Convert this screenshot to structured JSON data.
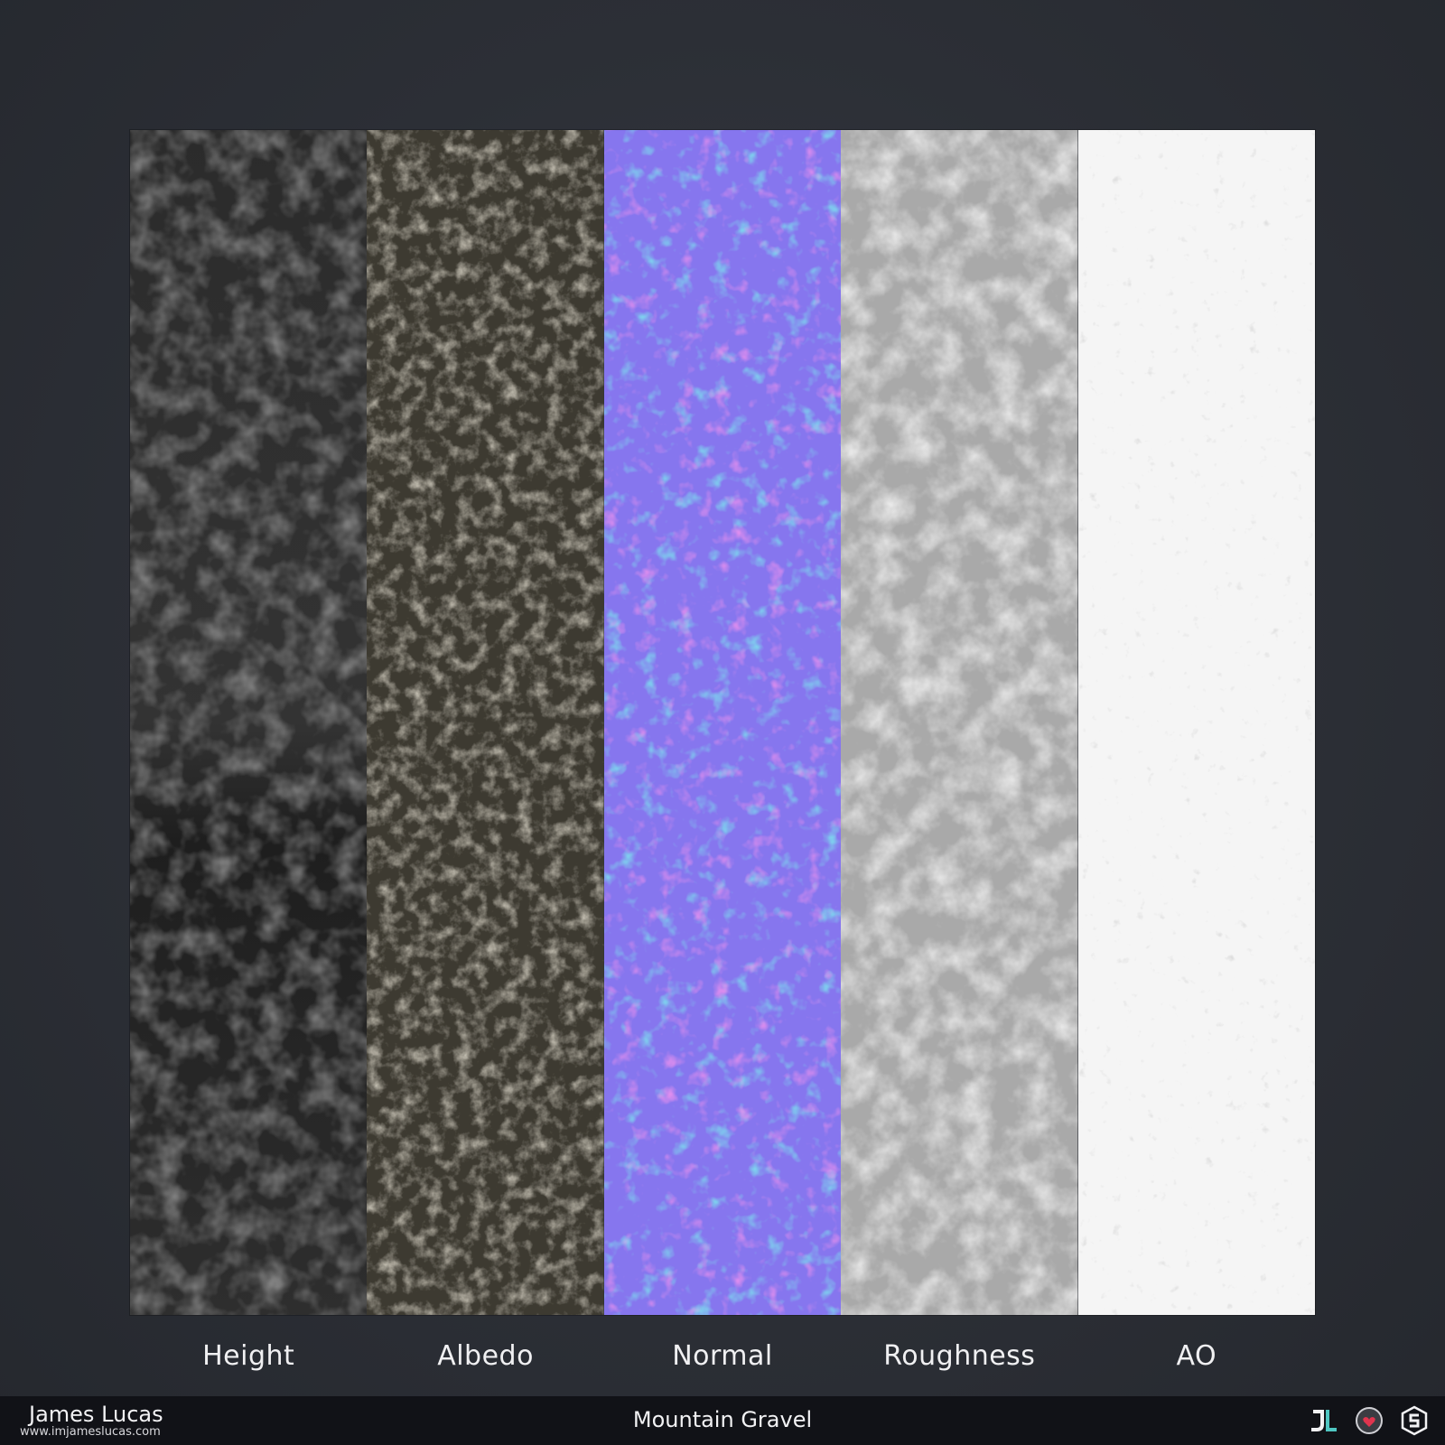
{
  "maps": [
    {
      "label": "Height",
      "color": "#3a3a3a"
    },
    {
      "label": "Albedo",
      "color": "#4a4538"
    },
    {
      "label": "Normal",
      "color": "#8a7af0"
    },
    {
      "label": "Roughness",
      "color": "#b8b8b8"
    },
    {
      "label": "AO",
      "color": "#f4f4f4"
    }
  ],
  "footer": {
    "author_name": "James Lucas",
    "author_url": "www.imjameslucas.com",
    "title": "Mountain Gravel"
  },
  "logos": [
    "jl-logo-icon",
    "substance-share-icon",
    "substance-designer-icon"
  ]
}
